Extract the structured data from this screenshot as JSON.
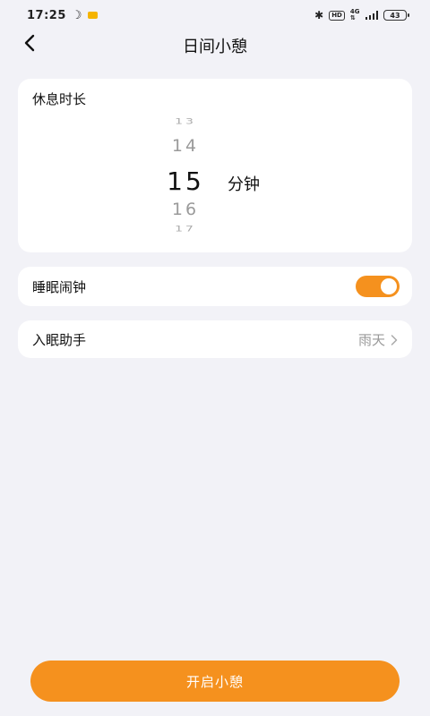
{
  "status_bar": {
    "time": "17:25",
    "battery": "43",
    "hd_label": "HD",
    "network_label": "4G"
  },
  "header": {
    "title": "日间小憩"
  },
  "duration": {
    "label": "休息时长",
    "picker_values": [
      "13",
      "14",
      "15",
      "16",
      "17"
    ],
    "selected_value": "15",
    "unit": "分钟"
  },
  "alarm": {
    "label": "睡眠闹钟",
    "enabled": true
  },
  "assistant": {
    "label": "入眠助手",
    "value": "雨天"
  },
  "actions": {
    "start_label": "开启小憩"
  },
  "colors": {
    "accent": "#f5911e",
    "background": "#f2f2f7"
  }
}
